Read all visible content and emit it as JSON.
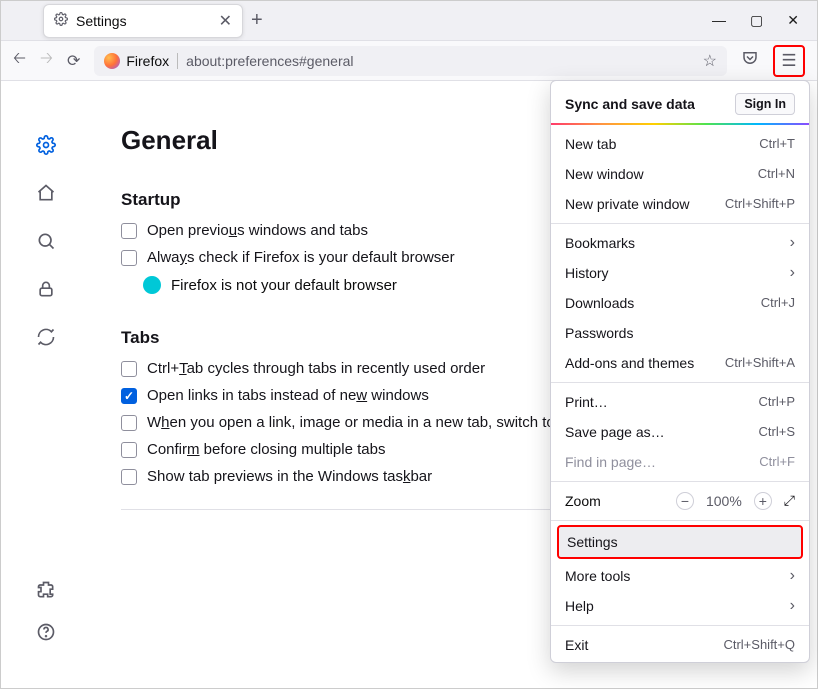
{
  "tab": {
    "title": "Settings"
  },
  "addressbar": {
    "identity": "Firefox",
    "url": "about:preferences#general"
  },
  "page": {
    "heading": "General",
    "startup": {
      "title": "Startup",
      "restore_pre": "Open previo",
      "restore_u": "u",
      "restore_post": "s windows and tabs",
      "default_pre": "Alwa",
      "default_u": "y",
      "default_post": "s check if Firefox is your default browser",
      "notdefault": "Firefox is not your default browser"
    },
    "tabs": {
      "title": "Tabs",
      "ctrlTab_pre": "Ctrl+",
      "ctrlTab_u": "T",
      "ctrlTab_post": "ab cycles through tabs in recently used order",
      "openLinks_pre": "Open links in tabs instead of ne",
      "openLinks_u": "w",
      "openLinks_post": " windows",
      "switch_pre": "W",
      "switch_u": "h",
      "switch_post": "en you open a link, image or media in a new tab, switch to it immediately",
      "confirm_pre": "Confir",
      "confirm_u": "m",
      "confirm_post": " before closing multiple tabs",
      "taskbar_pre": "Show tab previews in the Windows tas",
      "taskbar_u": "k",
      "taskbar_post": "bar"
    }
  },
  "menu": {
    "sync": "Sync and save data",
    "signin": "Sign In",
    "newtab": "New tab",
    "newtab_sc": "Ctrl+T",
    "newwin": "New window",
    "newwin_sc": "Ctrl+N",
    "newpriv": "New private window",
    "newpriv_sc": "Ctrl+Shift+P",
    "bookmarks": "Bookmarks",
    "history": "History",
    "downloads": "Downloads",
    "downloads_sc": "Ctrl+J",
    "passwords": "Passwords",
    "addons": "Add-ons and themes",
    "addons_sc": "Ctrl+Shift+A",
    "print": "Print…",
    "print_sc": "Ctrl+P",
    "save": "Save page as…",
    "save_sc": "Ctrl+S",
    "find": "Find in page…",
    "find_sc": "Ctrl+F",
    "zoom": "Zoom",
    "zoom_val": "100%",
    "settings": "Settings",
    "moretools": "More tools",
    "help": "Help",
    "exit": "Exit",
    "exit_sc": "Ctrl+Shift+Q"
  }
}
